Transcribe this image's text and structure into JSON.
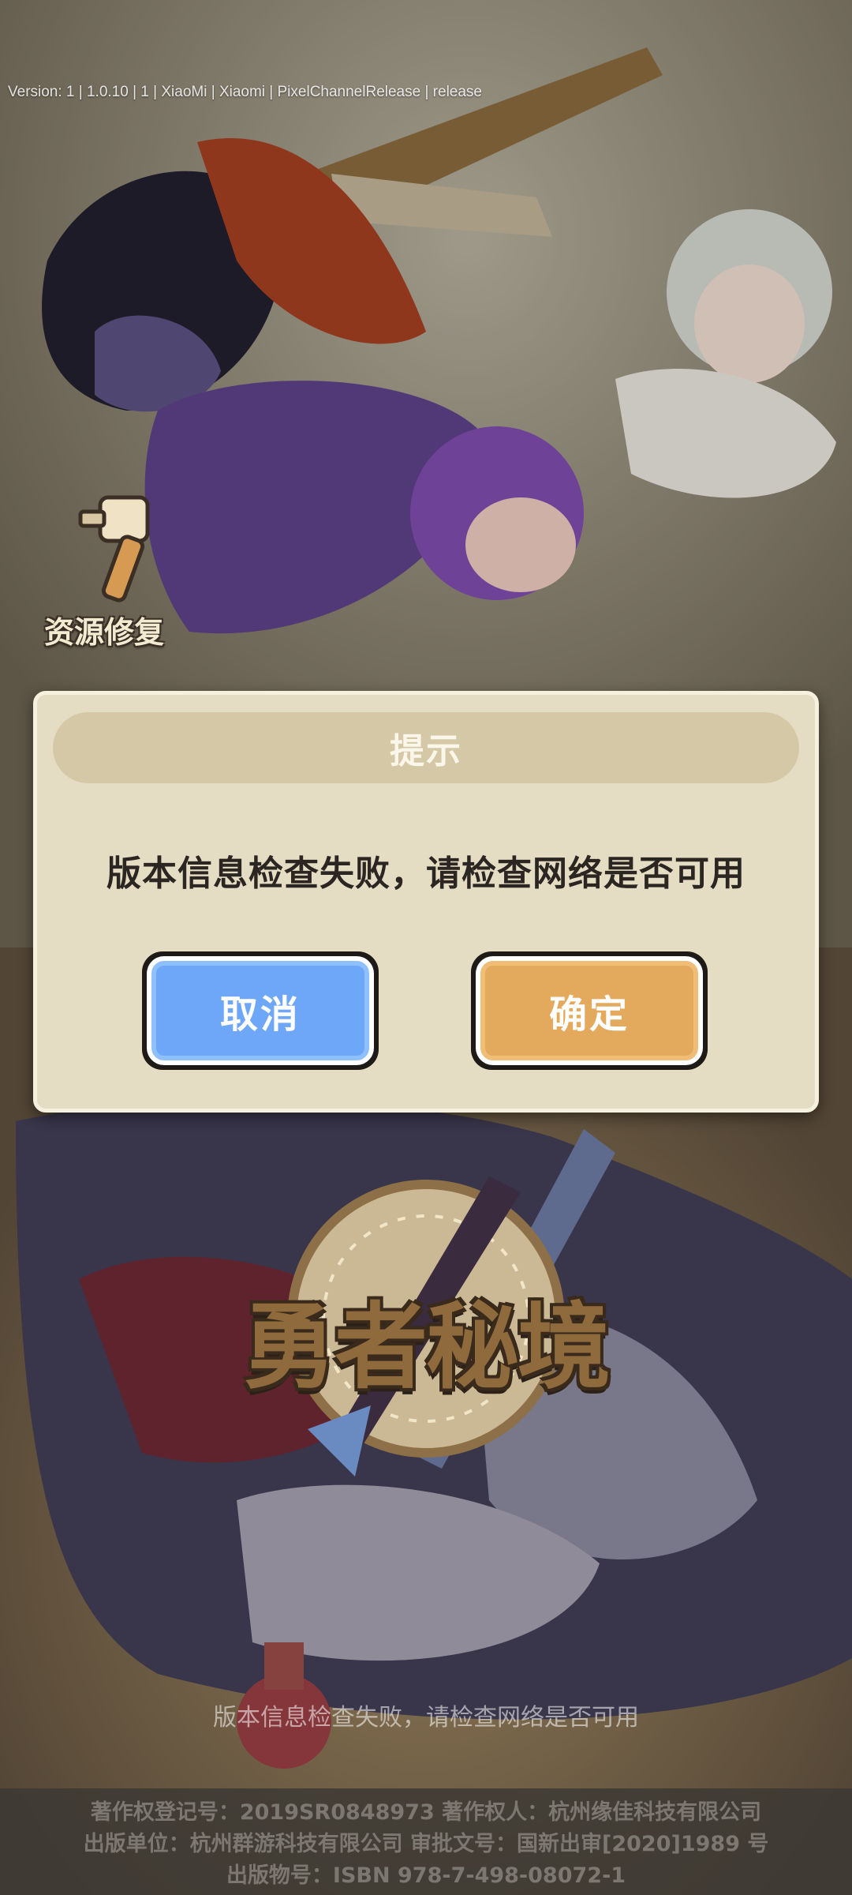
{
  "version_info": "Version: 1 | 1.0.10 | 1 | XiaoMi | Xiaomi | PixelChannelRelease | release",
  "repair": {
    "label": "资源修复",
    "icon": "hammer-icon"
  },
  "dialog": {
    "title": "提示",
    "message": "版本信息检查失败，请检查网络是否可用",
    "cancel_label": "取消",
    "confirm_label": "确定",
    "colors": {
      "cancel": "#6ea7f7",
      "confirm": "#e3a95c",
      "panel": "#e5dcc4",
      "title_bar": "#d5c8a7"
    }
  },
  "logo": {
    "text": "勇者秘境"
  },
  "footer": {
    "status_message": "版本信息检查失败，请检查网络是否可用",
    "copyright_reg": "著作权登记号：2019SR0848973 著作权人：杭州缘佳科技有限公司",
    "publisher": "出版单位：杭州群游科技有限公司 审批文号：国新出审[2020]1989 号",
    "isbn": "出版物号：ISBN 978-7-498-08072-1"
  }
}
